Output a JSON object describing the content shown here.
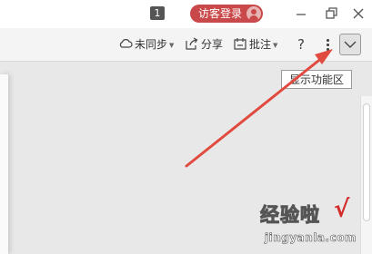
{
  "titlebar": {
    "tab_count": "1",
    "visitor_login_label": "访客登录"
  },
  "toolbar": {
    "sync_label": "未同步",
    "share_label": "分享",
    "comment_label": "批注",
    "help_label": "?"
  },
  "tooltip": {
    "text": "显示功能区"
  },
  "watermark": {
    "site_name": "经验啦",
    "site_url": "jingyanla.com"
  },
  "colors": {
    "visitor_button": "#c9494a",
    "arrow": "#e04a3f",
    "checkmark": "#d42a2a"
  }
}
